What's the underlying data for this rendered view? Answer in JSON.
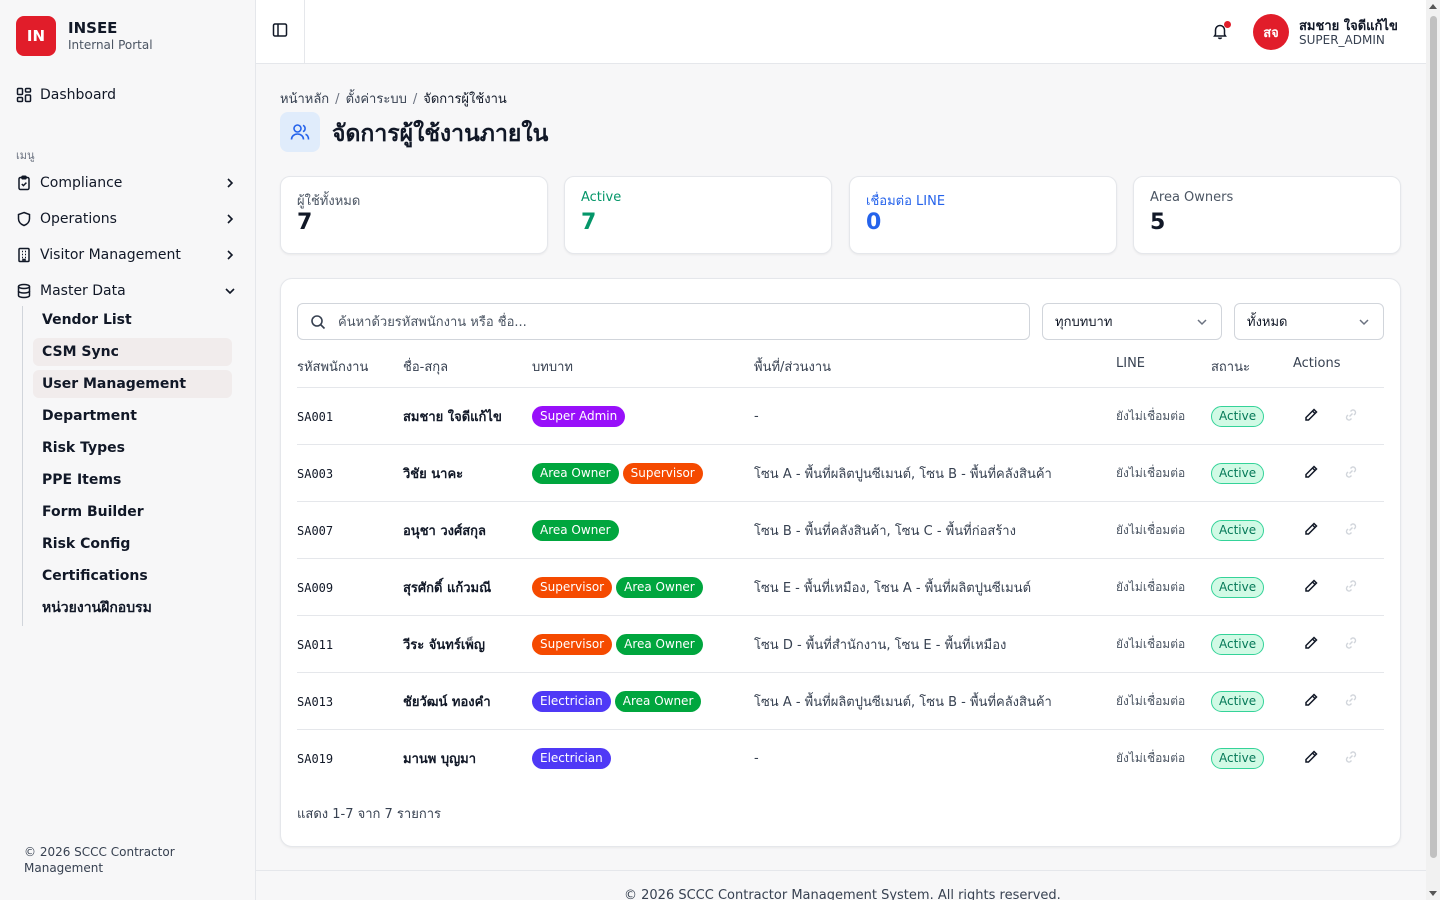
{
  "brand": {
    "logo": "IN",
    "name": "INSEE",
    "subtitle": "Internal Portal"
  },
  "sidebar": {
    "dashboard": "Dashboard",
    "section_label": "เมนู",
    "groups": [
      {
        "label": "Compliance",
        "icon": "clipboard-check-icon"
      },
      {
        "label": "Operations",
        "icon": "shield-icon"
      },
      {
        "label": "Visitor Management",
        "icon": "building-icon"
      },
      {
        "label": "Master Data",
        "icon": "database-icon"
      }
    ],
    "master_items": [
      "Vendor List",
      "CSM Sync",
      "User Management",
      "Department",
      "Risk Types",
      "PPE Items",
      "Form Builder",
      "Risk Config",
      "Certifications",
      "หน่วยงานฝึกอบรม"
    ],
    "footer": "© 2026 SCCC Contractor Management"
  },
  "header": {
    "avatar": "สจ",
    "user_name": "สมชาย ใจดีแก้ไข",
    "user_role": "SUPER_ADMIN"
  },
  "breadcrumb": [
    "หน้าหลัก",
    "ตั้งค่าระบบ",
    "จัดการผู้ใช้งาน"
  ],
  "page": {
    "title": "จัดการผู้ใช้งานภายใน"
  },
  "stats": [
    {
      "label": "ผู้ใช้ทั้งหมด",
      "value": "7",
      "color": "#4b5563",
      "value_color": "#111827"
    },
    {
      "label": "Active",
      "value": "7",
      "color": "#059669",
      "value_color": "#059669"
    },
    {
      "label": "เชื่อมต่อ LINE",
      "value": "0",
      "color": "#2563eb",
      "value_color": "#2563eb"
    },
    {
      "label": "Area Owners",
      "value": "5",
      "color": "#4b5563",
      "value_color": "#111827"
    }
  ],
  "filters": {
    "search_placeholder": "ค้นหาด้วยรหัสพนักงาน หรือ ชื่อ...",
    "role": "ทุกบทบาท",
    "status": "ทั้งหมด"
  },
  "table": {
    "headers": [
      "รหัสพนักงาน",
      "ชื่อ-สกุล",
      "บทบาท",
      "พื้นที่/ส่วนงาน",
      "LINE",
      "สถานะ",
      "Actions"
    ],
    "role_colors": {
      "Super Admin": "#9810fa",
      "Area Owner": "#00a63e",
      "Supervisor": "#f54a00",
      "Electrician": "#4f39f6"
    },
    "rows": [
      {
        "code": "SA001",
        "name": "สมชาย ใจดีแก้ไข",
        "roles": [
          "Super Admin"
        ],
        "area": "-",
        "line": "ยังไม่เชื่อมต่อ",
        "status": "Active"
      },
      {
        "code": "SA003",
        "name": "วิชัย นาคะ",
        "roles": [
          "Area Owner",
          "Supervisor"
        ],
        "area": "โซน A - พื้นที่ผลิตปูนซีเมนต์, โซน B - พื้นที่คลังสินค้า",
        "line": "ยังไม่เชื่อมต่อ",
        "status": "Active"
      },
      {
        "code": "SA007",
        "name": "อนุชา วงศ์สกุล",
        "roles": [
          "Area Owner"
        ],
        "area": "โซน B - พื้นที่คลังสินค้า, โซน C - พื้นที่ก่อสร้าง",
        "line": "ยังไม่เชื่อมต่อ",
        "status": "Active"
      },
      {
        "code": "SA009",
        "name": "สุรศักดิ์ แก้วมณี",
        "roles": [
          "Supervisor",
          "Area Owner"
        ],
        "area": "โซน E - พื้นที่เหมือง, โซน A - พื้นที่ผลิตปูนซีเมนต์",
        "line": "ยังไม่เชื่อมต่อ",
        "status": "Active"
      },
      {
        "code": "SA011",
        "name": "วีระ จันทร์เพ็ญ",
        "roles": [
          "Supervisor",
          "Area Owner"
        ],
        "area": "โซน D - พื้นที่สำนักงาน, โซน E - พื้นที่เหมือง",
        "line": "ยังไม่เชื่อมต่อ",
        "status": "Active"
      },
      {
        "code": "SA013",
        "name": "ชัยวัฒน์ ทองคำ",
        "roles": [
          "Electrician",
          "Area Owner"
        ],
        "area": "โซน A - พื้นที่ผลิตปูนซีเมนต์, โซน B - พื้นที่คลังสินค้า",
        "line": "ยังไม่เชื่อมต่อ",
        "status": "Active"
      },
      {
        "code": "SA019",
        "name": "มานพ บุญมา",
        "roles": [
          "Electrician"
        ],
        "area": "-",
        "line": "ยังไม่เชื่อมต่อ",
        "status": "Active"
      }
    ],
    "footer": "แสดง 1-7 จาก 7 รายการ"
  },
  "page_footer": "© 2026 SCCC Contractor Management System. All rights reserved."
}
